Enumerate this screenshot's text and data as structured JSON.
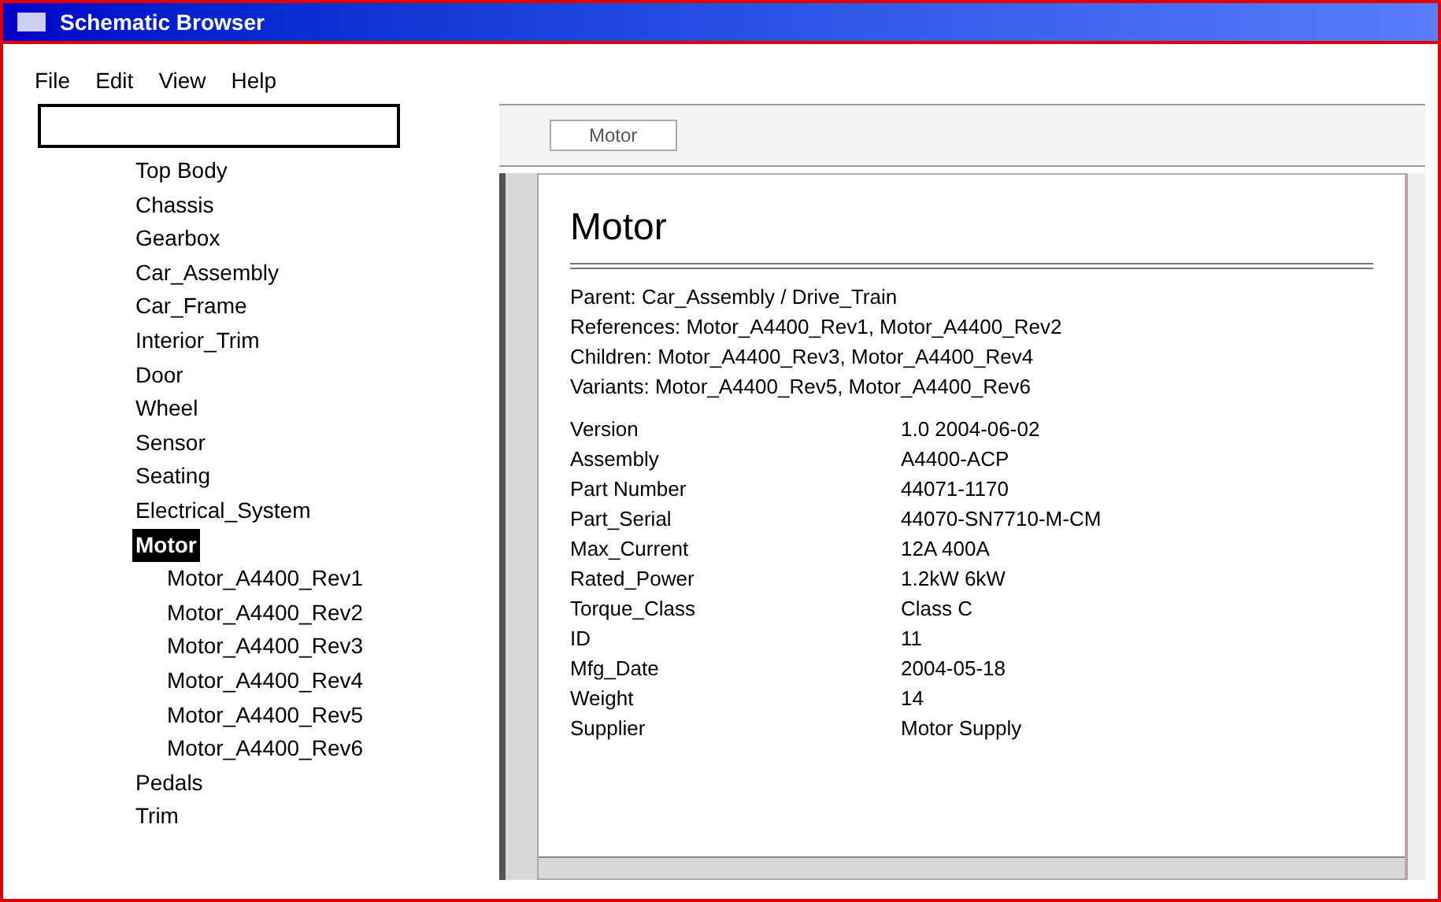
{
  "window": {
    "title": "Schematic Browser"
  },
  "menu": [
    "File",
    "Edit",
    "View",
    "Help"
  ],
  "tree": [
    {
      "label": "Top Body",
      "selected": false
    },
    {
      "label": "Chassis",
      "selected": false
    },
    {
      "label": "Gearbox",
      "selected": false
    },
    {
      "label": "Car_Assembly",
      "selected": false
    },
    {
      "label": "Car_Frame",
      "selected": false
    },
    {
      "label": "Interior_Trim",
      "selected": false
    },
    {
      "label": "Door",
      "selected": false
    },
    {
      "label": "Wheel",
      "selected": false
    },
    {
      "label": "Sensor",
      "selected": false
    },
    {
      "label": "Seating",
      "selected": false
    },
    {
      "label": "Electrical_System",
      "selected": false
    },
    {
      "label": "Motor",
      "selected": true,
      "children": [
        {
          "label": "Motor_A4400_Rev1",
          "selected": false
        },
        {
          "label": "Motor_A4400_Rev2",
          "selected": false
        },
        {
          "label": "Motor_A4400_Rev3",
          "selected": false
        },
        {
          "label": "Motor_A4400_Rev4",
          "selected": false
        },
        {
          "label": "Motor_A4400_Rev5",
          "selected": false
        },
        {
          "label": "Motor_A4400_Rev6",
          "selected": false
        }
      ]
    },
    {
      "label": "Pedals",
      "selected": false
    },
    {
      "label": "Trim",
      "selected": false
    }
  ],
  "toolbar": {
    "location": "Motor"
  },
  "detail": {
    "heading": "Motor",
    "lines": [
      "Parent: Car_Assembly / Drive_Train",
      "References: Motor_A4400_Rev1, Motor_A4400_Rev2",
      "Children: Motor_A4400_Rev3, Motor_A4400_Rev4",
      "Variants: Motor_A4400_Rev5, Motor_A4400_Rev6"
    ],
    "properties": [
      {
        "name": "Version",
        "value": "1.0 2004-06-02"
      },
      {
        "name": "Assembly",
        "value": "A4400-ACP"
      },
      {
        "name": "Part Number",
        "value": "44071-1170"
      },
      {
        "name": "Part_Serial",
        "value": "44070-SN7710-M-CM"
      },
      {
        "name": "Max_Current",
        "value": "12A 400A"
      },
      {
        "name": "Rated_Power",
        "value": "1.2kW 6kW"
      },
      {
        "name": "Torque_Class",
        "value": "Class C"
      },
      {
        "name": "ID",
        "value": "11"
      },
      {
        "name": "Mfg_Date",
        "value": "2004-05-18"
      },
      {
        "name": "Weight",
        "value": "14"
      },
      {
        "name": "Supplier",
        "value": "Motor Supply"
      }
    ]
  }
}
